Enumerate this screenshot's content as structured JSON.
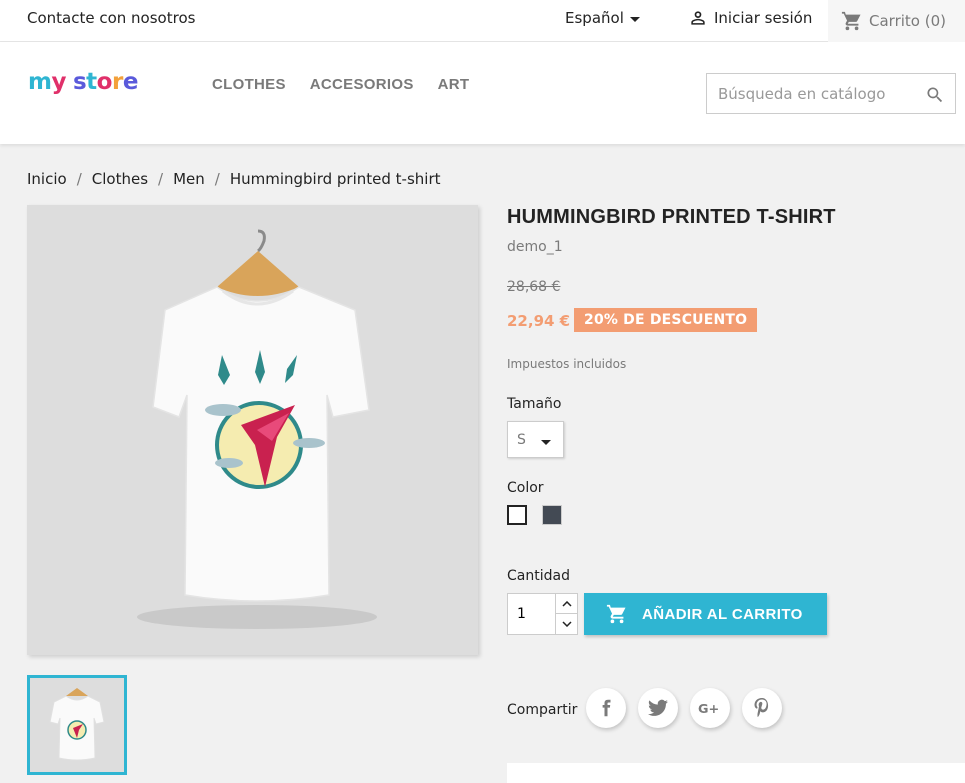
{
  "topbar": {
    "contact": "Contacte con nosotros",
    "language": "Español",
    "signin": "Iniciar sesión",
    "cart": "Carrito (0)"
  },
  "header": {
    "logo_word1": "my",
    "logo_word2": "store",
    "nav": [
      "CLOTHES",
      "ACCESORIOS",
      "ART"
    ],
    "search_placeholder": "Búsqueda en catálogo"
  },
  "breadcrumb": [
    "Inicio",
    "Clothes",
    "Men",
    "Hummingbird printed t-shirt"
  ],
  "product": {
    "title": "HUMMINGBIRD PRINTED T-SHIRT",
    "reference": "demo_1",
    "old_price": "28,68 €",
    "price": "22,94 €",
    "discount": "20% DE DESCUENTO",
    "tax_note": "Impuestos incluidos",
    "size_label": "Tamaño",
    "size_value": "S",
    "color_label": "Color",
    "colors": [
      "#ffffff",
      "#434a54"
    ],
    "quantity_label": "Cantidad",
    "quantity_value": "1",
    "add_to_cart": "AÑADIR AL CARRITO",
    "share_label": "Compartir"
  },
  "social": [
    {
      "icon": "facebook-icon"
    },
    {
      "icon": "twitter-icon"
    },
    {
      "icon": "google-plus-icon"
    },
    {
      "icon": "pinterest-icon"
    }
  ],
  "colors": {
    "accent": "#2fb5d2",
    "discount": "#f39d72",
    "background": "#f1f1f1"
  }
}
